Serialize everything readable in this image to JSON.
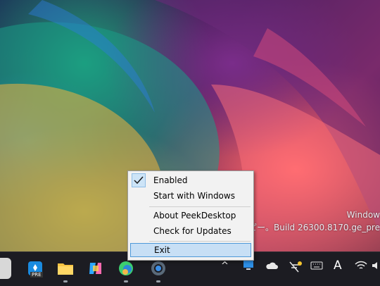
{
  "desktop": {
    "watermark_line1": "Window",
    "watermark_line2": "評価コピー。Build 26300.8170.ge_pre"
  },
  "context_menu": {
    "items": [
      {
        "label": "Enabled",
        "checked": true
      },
      {
        "label": "Start with Windows"
      },
      {
        "label": "About PeekDesktop"
      },
      {
        "label": "Check for Updates"
      },
      {
        "label": "Exit",
        "highlighted": true
      }
    ]
  },
  "taskbar": {
    "apps": [
      {
        "icon": "partial-app-icon"
      },
      {
        "icon": "store-preview-icon",
        "badge": "PRE"
      },
      {
        "icon": "file-explorer-icon"
      },
      {
        "icon": "copilot-icon"
      },
      {
        "icon": "edge-canary-icon"
      },
      {
        "icon": "settings-icon"
      }
    ],
    "tray": {
      "chevron": "^",
      "font_icon": "A"
    }
  },
  "colors": {
    "menu_bg": "#f2f2f2",
    "highlight": "#c7dff5",
    "highlight_border": "#4f9ad9",
    "taskbar_bg": "#1c1c22"
  }
}
